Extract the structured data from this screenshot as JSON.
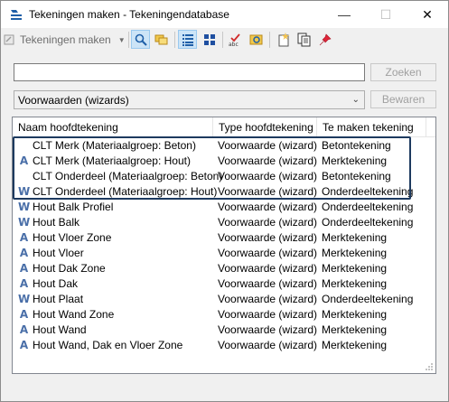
{
  "window": {
    "title": "Tekeningen maken - Tekeningendatabase",
    "minimize_glyph": "—",
    "maximize_glyph": "☐",
    "close_glyph": "✕"
  },
  "toolbar": {
    "dropdown_label": "Tekeningen maken",
    "buttons": [
      {
        "icon": "search-icon",
        "active": true
      },
      {
        "icon": "folders-icon",
        "active": false
      },
      {
        "icon": "details-view-icon",
        "active": true
      },
      {
        "icon": "tiles-view-icon",
        "active": false
      },
      {
        "icon": "spellcheck-icon",
        "active": false
      },
      {
        "icon": "refresh-icon",
        "active": false
      },
      {
        "icon": "new-item-icon",
        "active": false
      },
      {
        "icon": "copy-icon",
        "active": false
      },
      {
        "icon": "pin-icon",
        "active": false
      }
    ]
  },
  "search": {
    "value": "",
    "button_label": "Zoeken"
  },
  "filter": {
    "selected": "Voorwaarden (wizards)",
    "save_label": "Bewaren"
  },
  "list": {
    "columns": [
      "Naam hoofdtekening",
      "Type hoofdtekening",
      "Te maken tekening"
    ],
    "rows": [
      {
        "icon": "none",
        "name": "CLT Merk (Materiaalgroep: Beton)",
        "type": "Voorwaarde (wizard)",
        "target": "Betontekening"
      },
      {
        "icon": "A",
        "name": "CLT Merk (Materiaalgroep: Hout)",
        "type": "Voorwaarde (wizard)",
        "target": "Merktekening"
      },
      {
        "icon": "none",
        "name": "CLT Onderdeel (Materiaalgroep: Beton)",
        "type": "Voorwaarde (wizard)",
        "target": "Betontekening"
      },
      {
        "icon": "W",
        "name": "CLT Onderdeel (Materiaalgroep: Hout)",
        "type": "Voorwaarde (wizard)",
        "target": "Onderdeeltekening"
      },
      {
        "icon": "W",
        "name": "Hout Balk Profiel",
        "type": "Voorwaarde (wizard)",
        "target": "Onderdeeltekening"
      },
      {
        "icon": "W",
        "name": "Hout Balk",
        "type": "Voorwaarde (wizard)",
        "target": "Onderdeeltekening"
      },
      {
        "icon": "A",
        "name": "Hout Vloer Zone",
        "type": "Voorwaarde (wizard)",
        "target": "Merktekening"
      },
      {
        "icon": "A",
        "name": "Hout Vloer",
        "type": "Voorwaarde (wizard)",
        "target": "Merktekening"
      },
      {
        "icon": "A",
        "name": "Hout Dak Zone",
        "type": "Voorwaarde (wizard)",
        "target": "Merktekening"
      },
      {
        "icon": "A",
        "name": "Hout Dak",
        "type": "Voorwaarde (wizard)",
        "target": "Merktekening"
      },
      {
        "icon": "W",
        "name": "Hout Plaat",
        "type": "Voorwaarde (wizard)",
        "target": "Onderdeeltekening"
      },
      {
        "icon": "A",
        "name": "Hout Wand Zone",
        "type": "Voorwaarde (wizard)",
        "target": "Merktekening"
      },
      {
        "icon": "A",
        "name": "Hout Wand",
        "type": "Voorwaarde (wizard)",
        "target": "Merktekening"
      },
      {
        "icon": "A",
        "name": "Hout Wand, Dak en Vloer Zone",
        "type": "Voorwaarde (wizard)",
        "target": "Merktekening"
      }
    ]
  },
  "colors": {
    "highlight_border": "#1d3a5f",
    "icon_blue": "#4a6fa8",
    "active_button": "#cce4f7"
  }
}
